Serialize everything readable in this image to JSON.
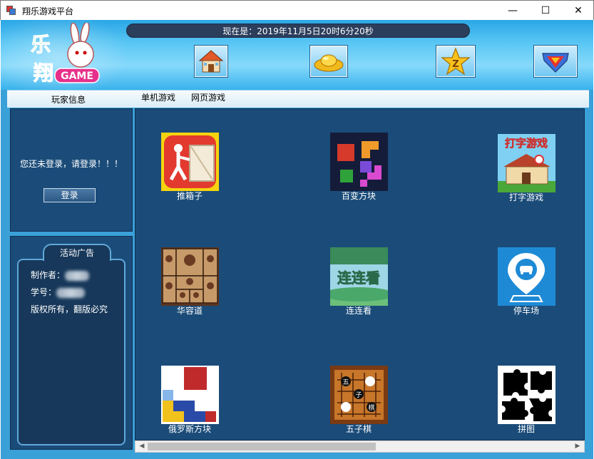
{
  "window": {
    "title": "翔乐游戏平台",
    "min_symbol": "—",
    "max_symbol": "☐",
    "close_symbol": "✕"
  },
  "header": {
    "datetime_text": "现在是：2019年11月5日20时6分20秒",
    "logo_text": "GAME",
    "nav_icons": [
      "home-icon",
      "gold-ingot-icon",
      "star-icon",
      "badge-icon"
    ]
  },
  "tabs": {
    "player_info": "玩家信息",
    "single_games": "单机游戏",
    "web_games": "网页游戏"
  },
  "login": {
    "message": "您还未登录，请登录！！！",
    "button": "登录"
  },
  "promo": {
    "tab_label": "活动广告",
    "author_label": "制作者：",
    "student_id_label": "学号：",
    "copyright": "版权所有，翻版必究"
  },
  "games": [
    {
      "name": "推箱子",
      "icon": "sokoban-icon"
    },
    {
      "name": "百变方块",
      "icon": "blocks-icon"
    },
    {
      "name": "打字游戏",
      "icon": "typing-icon"
    },
    {
      "name": "华容道",
      "icon": "huarong-icon"
    },
    {
      "name": "连连看",
      "icon": "lianliankan-icon"
    },
    {
      "name": "停车场",
      "icon": "parking-icon"
    },
    {
      "name": "俄罗斯方块",
      "icon": "tetris-icon"
    },
    {
      "name": "五子棋",
      "icon": "gomoku-icon"
    },
    {
      "name": "拼图",
      "icon": "puzzle-icon"
    }
  ],
  "game_thumb_text": {
    "typing": "打字游戏",
    "lianliankan": "连连看",
    "gomoku": [
      "五",
      "子",
      "棋"
    ]
  },
  "colors": {
    "panel": "#1b4c79",
    "banner": "#5cc8f5",
    "timebar": "#2b3e5c"
  }
}
